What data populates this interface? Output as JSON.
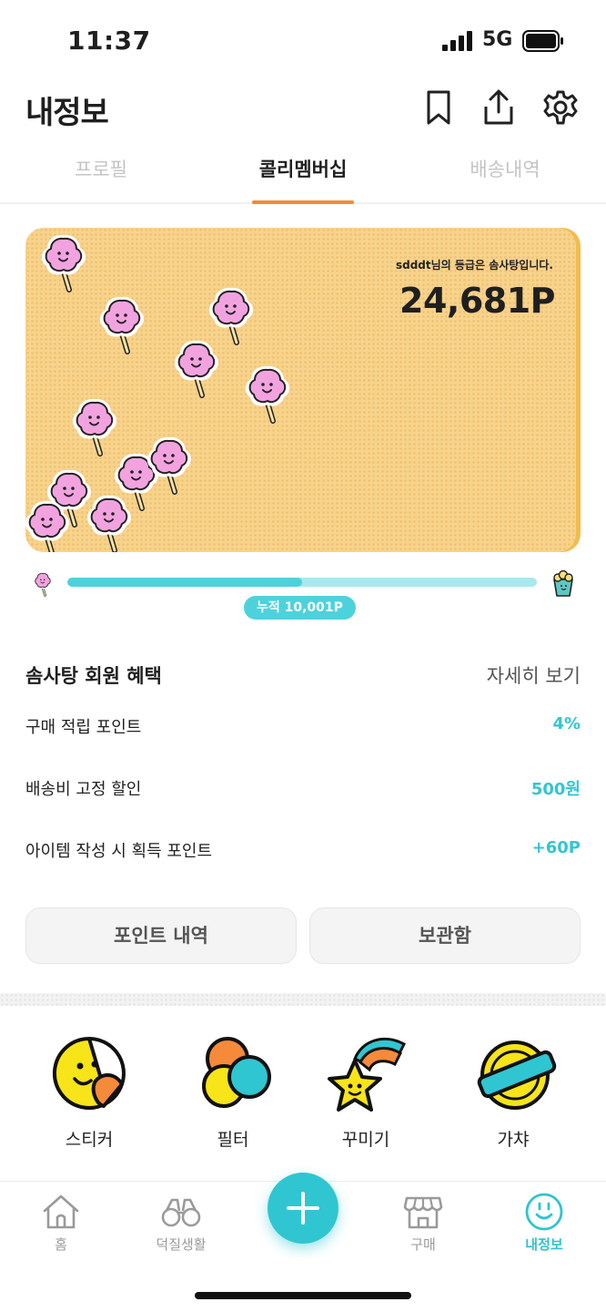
{
  "status_bar": {
    "time": "11:37",
    "network": "5G"
  },
  "header": {
    "title": "내정보",
    "icons": [
      "bookmark-icon",
      "share-icon",
      "gear-icon"
    ]
  },
  "tabs": [
    {
      "label": "프로필",
      "active": false
    },
    {
      "label": "콜리멤버십",
      "active": true
    },
    {
      "label": "배송내역",
      "active": false
    }
  ],
  "membership_card": {
    "grade_text": "sdddt님의 등급은 솜사탕입니다.",
    "points": "24,681P",
    "background_color": "#f7d38c",
    "accent_color": "#f2bc4d"
  },
  "progress": {
    "label": "누적 10,001P",
    "fraction": 0.5,
    "fill_color": "#4dd2dc",
    "track_color": "#a9e8ec"
  },
  "benefits": {
    "title": "솜사탕 회원 혜택",
    "more_label": "자세히 보기",
    "items": [
      {
        "label": "구매 적립 포인트",
        "value": "4%"
      },
      {
        "label": "배송비 고정 할인",
        "value": "500원"
      },
      {
        "label": "아이템 작성 시 획득 포인트",
        "value": "+60P"
      }
    ],
    "value_color": "#33c6d1"
  },
  "actions": {
    "points_history": "포인트 내역",
    "storage": "보관함"
  },
  "shortcuts": [
    {
      "label": "스티커",
      "icon": "sticker-icon"
    },
    {
      "label": "필터",
      "icon": "filter-icon"
    },
    {
      "label": "꾸미기",
      "icon": "decorate-star-icon"
    },
    {
      "label": "가챠",
      "icon": "gacha-icon"
    }
  ],
  "bottom_nav": {
    "items": [
      {
        "label": "홈",
        "icon": "home-icon",
        "active": false
      },
      {
        "label": "덕질생활",
        "icon": "binoculars-icon",
        "active": false
      },
      {
        "label": "구매",
        "icon": "shop-icon",
        "active": false
      },
      {
        "label": "내정보",
        "icon": "smiley-icon",
        "active": true
      }
    ],
    "fab_icon": "plus-icon",
    "accent_color": "#2ec4cf"
  }
}
